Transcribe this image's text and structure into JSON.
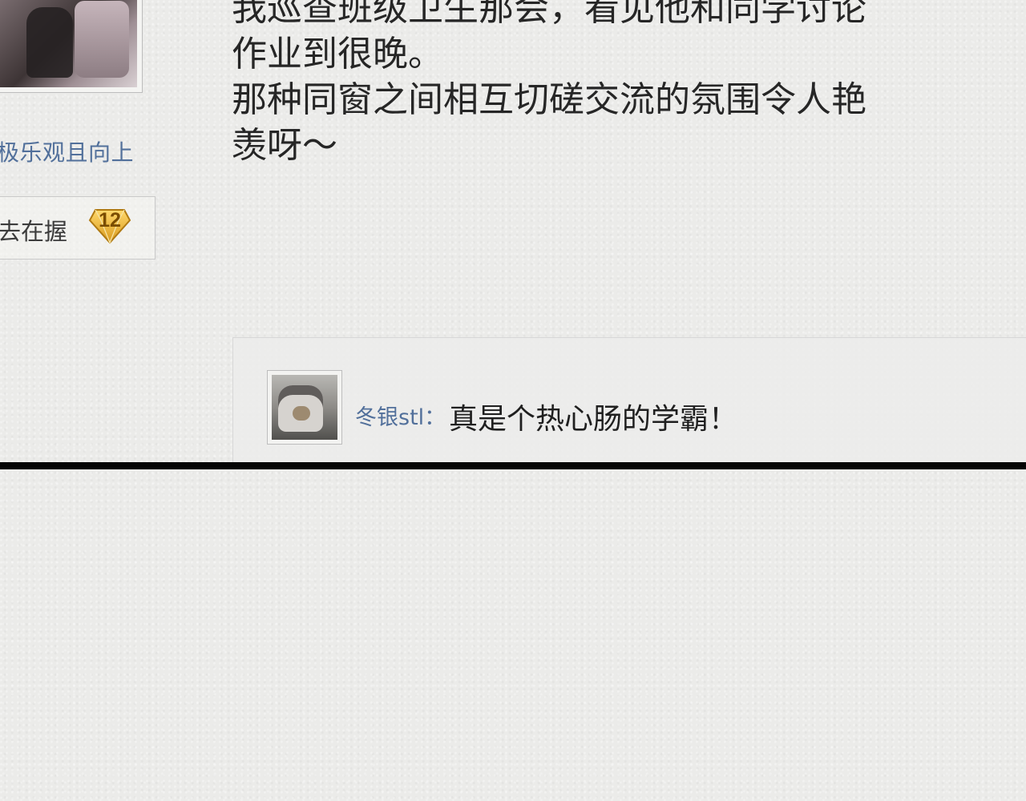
{
  "profile": {
    "signature": "极乐观且向上",
    "badge_label": "去在握",
    "level": "12"
  },
  "post": {
    "text": "我巡查班级卫生那会，看见他和同学讨论\n作业到很晚。\n那种同窗之间相互切磋交流的氛围令人艳\n羡呀～"
  },
  "reply": {
    "username": "冬银stl：",
    "text": "真是个热心肠的学霸！"
  }
}
